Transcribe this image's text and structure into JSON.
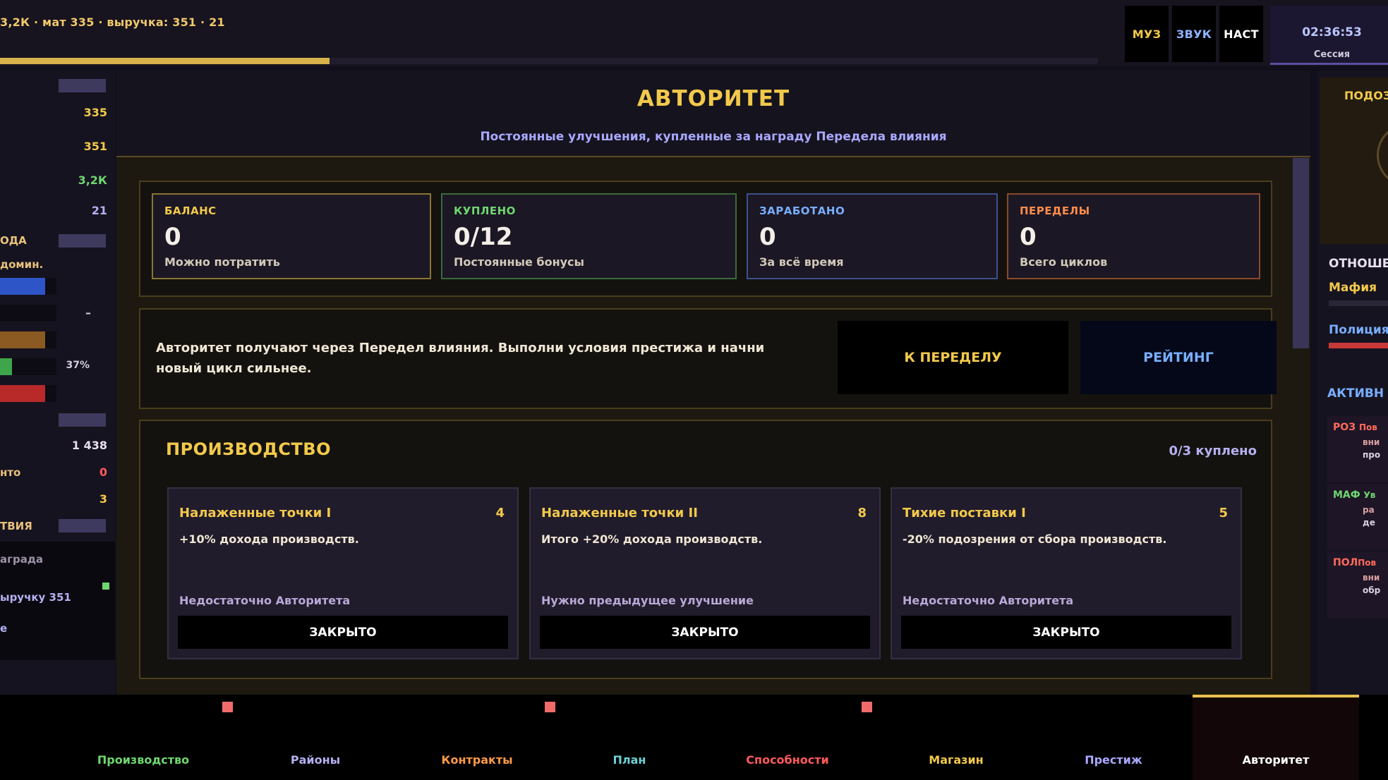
{
  "topbar": {
    "stats_line": "3,2К · мат 335 · выручка: 351 ·  21",
    "progress_fraction": 0.3,
    "buttons": {
      "music": "МУЗ",
      "sound": "ЗВУК",
      "settings": "НАСТ"
    },
    "clock": "02:36:53",
    "clock_label": "Сессия"
  },
  "left_sidebar": {
    "values": {
      "mat": "335",
      "revenue": "351",
      "cash": "3,2К",
      "count": "21"
    },
    "label_income": "ОДА",
    "label_domination": "домин.",
    "meters": [
      {
        "fill_fraction": 0.8,
        "color": "#2d55c8"
      },
      {
        "fill_fraction": 0.0,
        "color": "#2a2638",
        "value": "–"
      },
      {
        "fill_fraction": 0.8,
        "color": "#8a5a22"
      },
      {
        "fill_fraction": 0.21,
        "color": "#3ea64a",
        "value": "37%"
      },
      {
        "fill_fraction": 0.8,
        "color": "#b82a2a"
      }
    ],
    "value_1438": "1 438",
    "label_to": "нто",
    "value_red_zero": "0",
    "value_three": "3",
    "label_actions": "ТВИЯ",
    "reward_label": "аграда",
    "reward_text": "ыручку 351",
    "reward_more": "е"
  },
  "main": {
    "title": "АВТОРИТЕТ",
    "subtitle": "Постоянные улучшения, купленные за награду Передела влияния",
    "stats": [
      {
        "label": "БАЛАНС",
        "value": "0",
        "sub": "Можно потратить",
        "color": "#f2c94c",
        "border": "#8a7433"
      },
      {
        "label": "КУПЛЕНО",
        "value": "0/12",
        "sub": "Постоянные бонусы",
        "color": "#6fd66f",
        "border": "#3a6a3a"
      },
      {
        "label": "ЗАРАБОТАНО",
        "value": "0",
        "sub": "За всё время",
        "color": "#78aeff",
        "border": "#3d4f8c"
      },
      {
        "label": "ПЕРЕДЕЛЫ",
        "value": "0",
        "sub": "Всего циклов",
        "color": "#ff8c4a",
        "border": "#8a4a2c"
      }
    ],
    "info_text": "Авторитет получают через Передел влияния. Выполни условия престижа и начни новый цикл сильнее.",
    "btn_to_peredel": "К ПЕРЕДЕЛУ",
    "btn_rating": "РЕЙТИНГ",
    "section_title": "ПРОИЗВОДСТВО",
    "section_count": "0/3 куплено",
    "cards": [
      {
        "name": "Налаженные точки I",
        "cost": "4",
        "desc": "+10% дохода производств.",
        "hint": "Недостаточно Авторитета",
        "button": "ЗАКРЫТО"
      },
      {
        "name": "Налаженные точки II",
        "cost": "8",
        "desc": "Итого +20% дохода производств.",
        "hint": "Нужно предыдущее улучшение",
        "button": "ЗАКРЫТО"
      },
      {
        "name": "Тихие поставки I",
        "cost": "5",
        "desc": "-20% подозрения от сбора производств.",
        "hint": "Недостаточно Авторитета",
        "button": "ЗАКРЫТО"
      }
    ]
  },
  "right_sidebar": {
    "suspicion_label": "ПОДОЗ",
    "relations_label": "ОТНОШЕ",
    "mafia_label": "Мафия",
    "police_label": "Полиция",
    "active_label": "АКТИВН",
    "events": [
      {
        "tag": "РОЗ",
        "tag_color": "#ff6b5b",
        "line1": "Пов",
        "line2": "вни",
        "line3": "про"
      },
      {
        "tag": "МАФ",
        "tag_color": "#6fd66f",
        "line1": "Ув",
        "line2": "ра",
        "line3": "де"
      },
      {
        "tag": "ПОЛ",
        "tag_color": "#ff6b5b",
        "line1": "Пов",
        "line2": "вни",
        "line3": "обр"
      }
    ]
  },
  "bottom_nav": {
    "tabs": [
      {
        "label": "Производство",
        "color": "#6fd66f"
      },
      {
        "label": "Районы",
        "color": "#b5b0f0"
      },
      {
        "label": "Контракты",
        "color": "#ff9a4a"
      },
      {
        "label": "План",
        "color": "#6fd0d6"
      },
      {
        "label": "Способности",
        "color": "#ff5a5a"
      },
      {
        "label": "Магазин",
        "color": "#f2c94c"
      },
      {
        "label": "Престиж",
        "color": "#a9a8ff"
      },
      {
        "label": "Авторитет",
        "color": "#ffffff"
      }
    ],
    "active_tab": "Авторитет"
  }
}
